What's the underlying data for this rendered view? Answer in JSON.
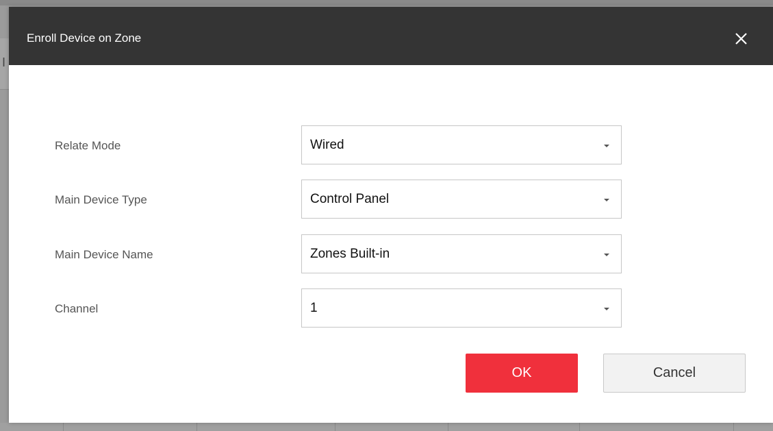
{
  "background": {
    "left_fragment": "I"
  },
  "dialog": {
    "title": "Enroll Device on Zone",
    "close_icon": "close-icon",
    "fields": [
      {
        "label": "Relate Mode",
        "value": "Wired"
      },
      {
        "label": "Main Device Type",
        "value": "Control Panel"
      },
      {
        "label": "Main Device Name",
        "value": "Zones Built-in"
      },
      {
        "label": "Channel",
        "value": "1"
      }
    ],
    "ok_label": "OK",
    "cancel_label": "Cancel"
  },
  "colors": {
    "header_bg": "#343434",
    "ok_bg": "#f0303c",
    "cancel_bg": "#f2f2f2"
  }
}
